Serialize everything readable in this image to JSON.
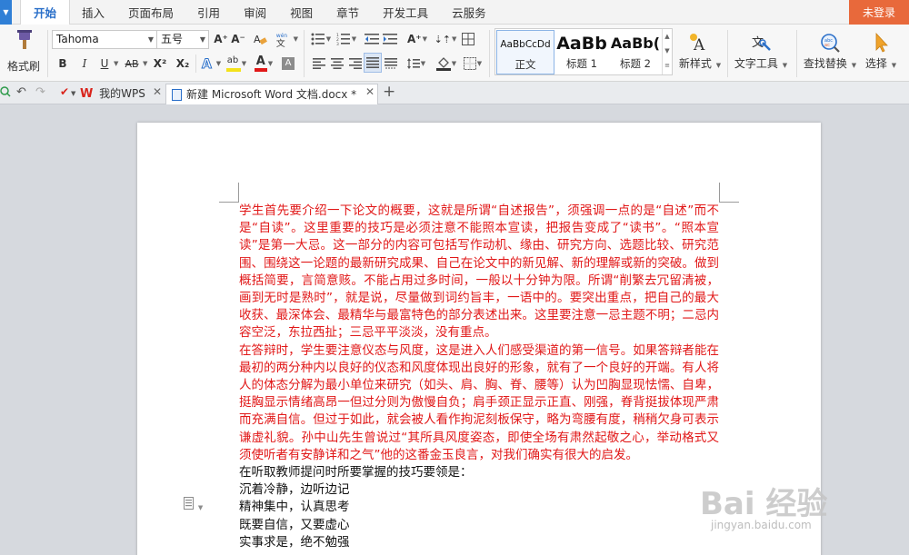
{
  "menu": {
    "tabs": [
      "开始",
      "插入",
      "页面布局",
      "引用",
      "审阅",
      "视图",
      "章节",
      "开发工具",
      "云服务"
    ],
    "login": "未登录"
  },
  "ribbon": {
    "format_painter": "格式刷",
    "font_name": "Tahoma",
    "font_size": "五号",
    "bold": "B",
    "italic": "I",
    "underline": "U",
    "strike": "AB",
    "superscript": "X²",
    "subscript": "X₂",
    "grow_font": "A⁺",
    "shrink_font": "A⁻",
    "font_color_glyph": "A",
    "highlight_glyph": "ab",
    "styles": [
      {
        "sample": "AaBbCcDd",
        "name": "正文"
      },
      {
        "sample": "AaBb",
        "name": "标题 1"
      },
      {
        "sample": "AaBb(",
        "name": "标题 2"
      }
    ],
    "new_style": "新样式",
    "text_tools": "文字工具",
    "find_replace": "查找替换",
    "select": "选择"
  },
  "tabs": [
    {
      "label": "我的WPS"
    },
    {
      "label": "新建 Microsoft Word 文档.docx *"
    }
  ],
  "colors": {
    "accent": "#2a6fc9",
    "login_bg": "#e8693b",
    "doc_text_red": "#e11818",
    "wps_red": "#d9241c"
  },
  "document": {
    "paragraphs": [
      {
        "text": "学生首先要介绍一下论文的概要，这就是所谓“自述报告”，须强调一点的是“自述”而不是“自读”。这里重要的技巧是必须注意不能照本宣读，把报告变成了“读书”。“照本宣读”是第一大忌。这一部分的内容可包括写作动机、缘由、研究方向、选题比较、研究范围、围绕这一论题的最新研究成果、自己在论文中的新见解、新的理解或新的突破。做到概括简要，言简意赅。不能占用过多时间，一般以十分钟为限。所谓“削繁去冗留清被，画到无时是熟时”，就是说，尽量做到词约旨丰，一语中的。要突出重点，把自己的最大收获、最深体会、最精华与最富特色的部分表述出来。这里要注意一忌主题不明；二忌内容空泛，东拉西扯；三忌平平淡淡，没有重点。",
        "color": "red"
      },
      {
        "text": "在答辩时，学生要注意仪态与风度，这是进入人们感受渠道的第一信号。如果答辩者能在最初的两分种内以良好的仪态和风度体现出良好的形象，就有了一个良好的开端。有人将人的体态分解为最小单位来研究（如头、肩、胸、脊、腰等）认为凹胸显现怯懦、自卑，挺胸显示情绪高昂一但过分则为傲慢自负；肩手颈正显示正直、刚强，脊背挺拔体现严肃而充满自信。但过于如此，就会被人看作拘泥刻板保守，略为弯腰有度，稍稍欠身可表示谦虚礼貌。孙中山先生曾说过“其所具风度姿态，即使全场有肃然起敬之心，举动格式又须使听者有安静详和之气”他的这番金玉良言，对我们确实有很大的启发。",
        "color": "red"
      },
      {
        "text": "在听取教师提问时所要掌握的技巧要领是：",
        "color": "black"
      },
      {
        "text": "沉着冷静，边听边记",
        "color": "black"
      },
      {
        "text": "精神集中，认真思考",
        "color": "black"
      },
      {
        "text": "既要自信，又要虚心",
        "color": "black"
      },
      {
        "text": "实事求是，绝不勉强",
        "color": "black"
      }
    ]
  },
  "watermark": {
    "main": "Bai 经验",
    "sub": "jingyan.baidu.com"
  }
}
